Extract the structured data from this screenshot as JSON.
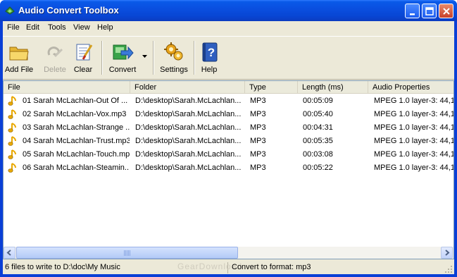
{
  "window": {
    "title": "Audio Convert Toolbox"
  },
  "menu": [
    "File",
    "Edit",
    "Tools",
    "View",
    "Help"
  ],
  "toolbar": {
    "add_file": "Add File",
    "delete": "Delete",
    "clear": "Clear",
    "convert": "Convert",
    "settings": "Settings",
    "help": "Help"
  },
  "columns": [
    "File",
    "Folder",
    "Type",
    "Length (ms)",
    "Audio Properties"
  ],
  "files": [
    {
      "file": "01 Sarah McLachlan-Out Of ...",
      "folder": "D:\\desktop\\Sarah.McLachlan...",
      "type": "MP3",
      "length": "00:05:09",
      "props": "MPEG 1.0 layer-3: 44,1("
    },
    {
      "file": "02 Sarah McLachlan-Vox.mp3",
      "folder": "D:\\desktop\\Sarah.McLachlan...",
      "type": "MP3",
      "length": "00:05:40",
      "props": "MPEG 1.0 layer-3: 44,1("
    },
    {
      "file": "03 Sarah McLachlan-Strange ...",
      "folder": "D:\\desktop\\Sarah.McLachlan...",
      "type": "MP3",
      "length": "00:04:31",
      "props": "MPEG 1.0 layer-3: 44,1("
    },
    {
      "file": "04 Sarah McLachlan-Trust.mp3",
      "folder": "D:\\desktop\\Sarah.McLachlan...",
      "type": "MP3",
      "length": "00:05:35",
      "props": "MPEG 1.0 layer-3: 44,1("
    },
    {
      "file": "05 Sarah McLachlan-Touch.mp3",
      "folder": "D:\\desktop\\Sarah.McLachlan...",
      "type": "MP3",
      "length": "00:03:08",
      "props": "MPEG 1.0 layer-3: 44,1("
    },
    {
      "file": "06 Sarah McLachlan-Steamin...",
      "folder": "D:\\desktop\\Sarah.McLachlan...",
      "type": "MP3",
      "length": "00:05:22",
      "props": "MPEG 1.0 layer-3: 44,1("
    }
  ],
  "status": {
    "left": "6 files to write to D:\\doc\\My Music",
    "right": "Convert to format: mp3",
    "watermark": "GearDownload"
  },
  "colors": {
    "titlebar": "#0a4fe0",
    "face": "#ece9d8",
    "note_icon": "#e8a800"
  }
}
